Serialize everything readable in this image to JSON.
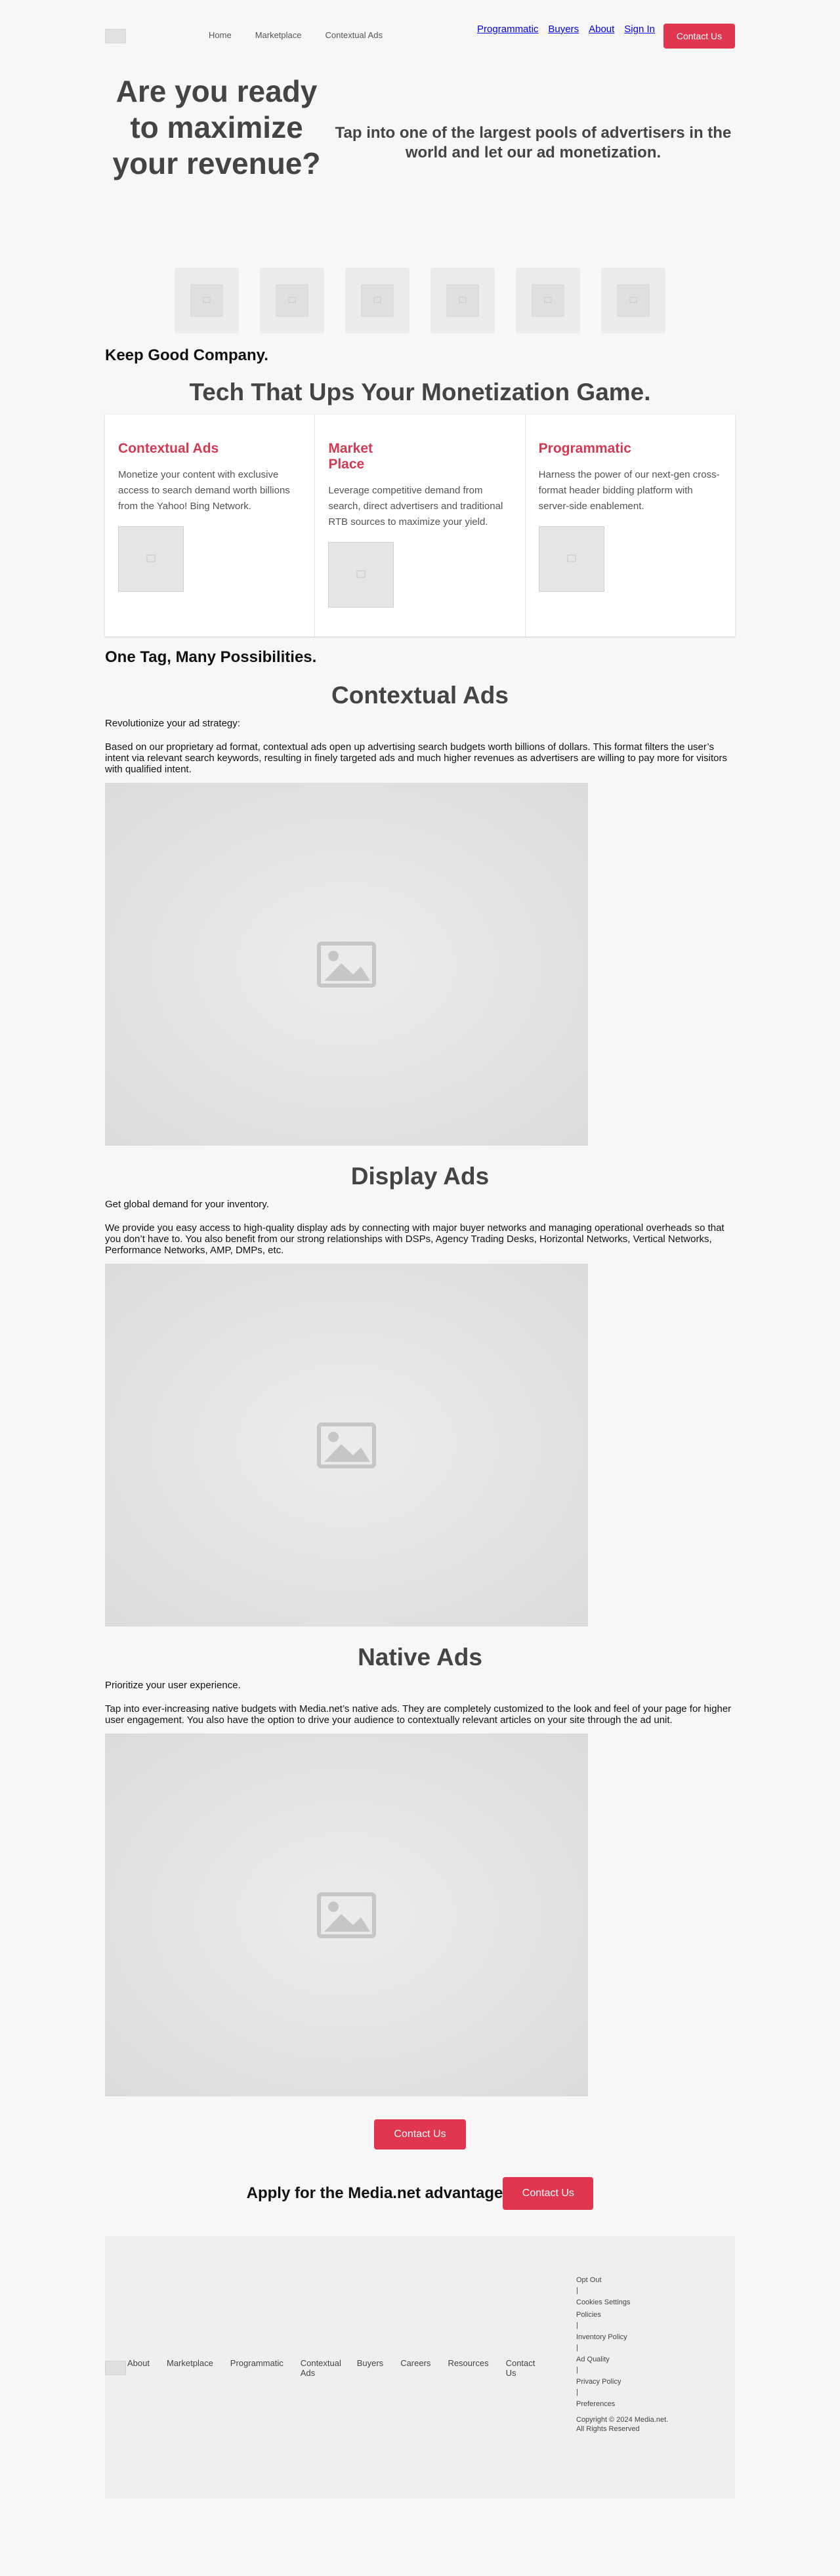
{
  "nav": {
    "menu": [
      "Home",
      "Marketplace",
      "Contextual Ads"
    ],
    "links": [
      "Programmatic",
      "Buyers",
      "About",
      "Sign In"
    ],
    "cta_label": "Contact Us"
  },
  "hero": {
    "title": "Are you ready to maximize your revenue?",
    "subtitle": "Tap into one of the largest pools of advertisers in the world and let our ad monetization."
  },
  "partners_heading": "Keep Good Company.",
  "tech_heading": "Tech That Ups Your Monetization Game.",
  "cards": [
    {
      "title": "Contextual Ads",
      "text": "Monetize your content with exclusive access to search demand worth billions from the Yahoo! Bing Network."
    },
    {
      "title": "Market Place",
      "text": "Leverage competitive demand from search, direct advertisers and traditional RTB sources to maximize your yield."
    },
    {
      "title": "Programmatic",
      "text": "Harness the power of our next-gen cross-format header bidding platform with server-side enablement."
    }
  ],
  "onetag_heading": "One Tag, Many Possibilities.",
  "sections": [
    {
      "title": "Contextual Ads",
      "intro": "Revolutionize your ad strategy:",
      "body": "Based on our proprietary ad format, contextual ads open up advertising search budgets worth billions of dollars. This format filters the user’s intent via relevant search keywords, resulting in finely targeted ads and much higher revenues as advertisers are willing to pay more for visitors with qualified intent."
    },
    {
      "title": "Display Ads",
      "intro": "Get global demand for your inventory.",
      "body": "We provide you easy access to high-quality display ads by connecting with major buyer networks and managing operational overheads so that you don’t have to. You also benefit from our strong relationships with DSPs, Agency Trading Desks, Horizontal Networks, Vertical Networks, Performance Networks, AMP, DMPs, etc."
    },
    {
      "title": "Native Ads",
      "intro": "Prioritize your user experience.",
      "body": "Tap into ever-increasing native budgets with Media.net’s native ads. They are completely customized to the look and feel of your page for higher user engagement. You also have the option to drive your audience to contextually relevant articles on your site through the ad unit."
    }
  ],
  "cta_label": "Contact Us",
  "apply": {
    "heading": "Apply for the Media.net advantage",
    "button": "Contact Us"
  },
  "footer": {
    "nav": [
      "About",
      "Marketplace",
      "Programmatic",
      "Contextual Ads",
      "Buyers",
      "Careers",
      "Resources",
      "Contact Us"
    ],
    "legal": [
      "Opt Out",
      "Cookies Settings",
      "Policies",
      "Inventory Policy",
      "Ad Quality",
      "Privacy Policy",
      "Preferences"
    ],
    "separator": "|",
    "copyright": "Copyright © 2024 Media.net. All Rights Reserved"
  },
  "colors": {
    "accent": "#e0364f",
    "card_title": "#d33a52",
    "background": "#f7f7f7"
  },
  "icons": {
    "image_placeholder": "image-placeholder-icon"
  }
}
